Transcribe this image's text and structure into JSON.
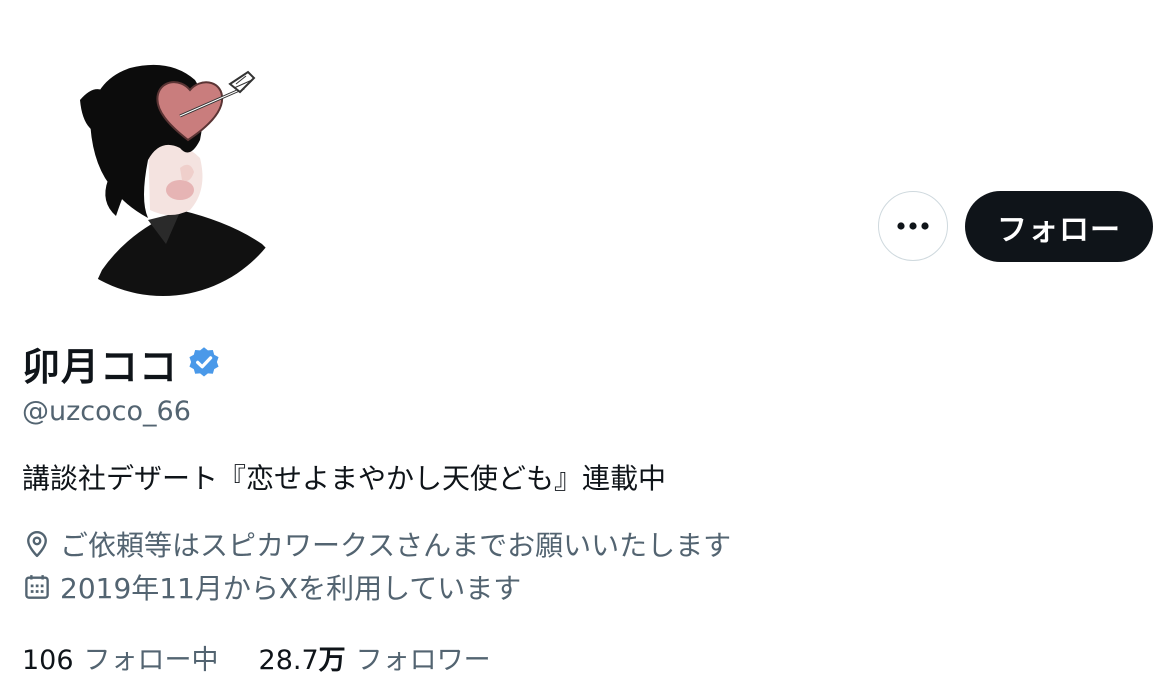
{
  "profile": {
    "display_name": "卯月ココ",
    "handle": "@uzcoco_66",
    "bio": "講談社デザート『恋せよまやかし天使ども』連載中",
    "location": "ご依頼等はスピカワークスさんまでお願いいたします",
    "joined": "2019年11月からXを利用しています",
    "verified_icon": "verified-badge-icon",
    "verified_color": "#4a99e9"
  },
  "actions": {
    "more_icon": "more-dots-icon",
    "follow_label": "フォロー"
  },
  "stats": {
    "following_count": "106",
    "following_label": "フォロー中",
    "followers_number": "28.7",
    "followers_unit": "万",
    "followers_label": "フォロワー"
  },
  "icons": {
    "location": "location-pin-icon",
    "calendar": "calendar-icon"
  },
  "colors": {
    "text_primary": "#0f1419",
    "text_secondary": "#536471",
    "follow_bg": "#0f1419",
    "heart": "#c97d7d"
  }
}
